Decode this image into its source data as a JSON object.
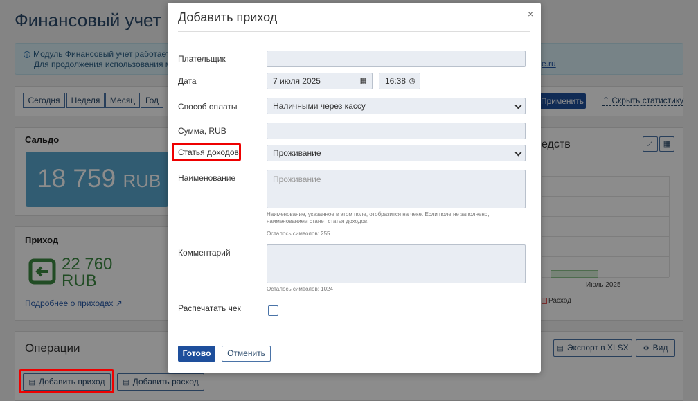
{
  "page": {
    "title": "Финансовый учет",
    "info_line1": "Модуль Финансовый учет работает в",
    "info_line2": "Для продолжения использования мо",
    "info_link": "e.ru"
  },
  "filters": {
    "periods": [
      "Сегодня",
      "Неделя",
      "Месяц",
      "Год"
    ],
    "apply_label": "Применить",
    "hide_stats_label": "Скрыть статистику"
  },
  "saldo": {
    "title": "Сальдо",
    "value": "18 759",
    "currency": "RUB"
  },
  "income": {
    "title": "Приход",
    "value": "22 760",
    "currency": "RUB",
    "details_link": "Подробнее о приходах"
  },
  "chart": {
    "title_fragment": "едств",
    "x_label": "Июль 2025",
    "legend": "Расход"
  },
  "chart_data": {
    "type": "bar",
    "categories": [
      "Июль 2025"
    ],
    "series": [
      {
        "name": "Расход",
        "values": [
          0
        ]
      }
    ]
  },
  "operations": {
    "title": "Операции",
    "add_income_label": "Добавить приход",
    "add_expense_label": "Добавить расход",
    "export_label": "Экспорт в XLSX",
    "view_label": "Вид"
  },
  "modal": {
    "title": "Добавить приход",
    "close": "×",
    "payer_label": "Плательщик",
    "payer_value": "",
    "date_label": "Дата",
    "date_value": "7 июля 2025",
    "time_value": "16:38",
    "payment_label": "Способ оплаты",
    "payment_value": "Наличными через кассу",
    "amount_label": "Сумма, RUB",
    "amount_value": "",
    "category_label": "Статья доходов",
    "category_value": "Проживание",
    "name_label": "Наименование",
    "name_placeholder": "Проживание",
    "name_hint": "Наименование, указанное в этом поле, отобразится на чеке. Если поле не заполнено, наименованием станет статья доходов.",
    "name_counter": "Осталось символов: 255",
    "comment_label": "Комментарий",
    "comment_counter": "Осталось символов: 1024",
    "print_label": "Распечатать чек",
    "submit_label": "Готово",
    "cancel_label": "Отменить"
  }
}
